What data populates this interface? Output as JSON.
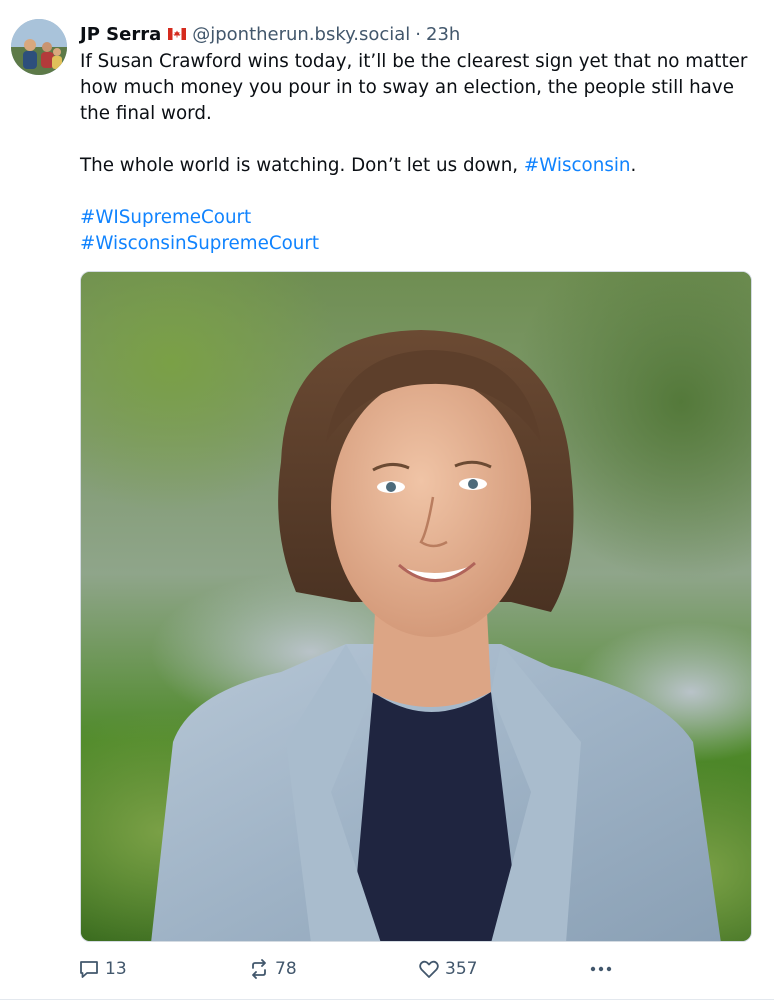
{
  "post": {
    "author": {
      "display_name": "JP Serra",
      "flag": "🇨🇦",
      "handle": "@jpontherun.bsky.social",
      "separator": "·",
      "time": "23h"
    },
    "text_para1": "If Susan Crawford wins today, it’ll be the clearest sign yet that no matter how much money you pour in to sway an election, the people still have the final word.",
    "text_para2_prefix": "The whole world is watching. Don’t let us down, ",
    "text_para2_tag": "#Wisconsin",
    "text_para2_suffix": ".",
    "hashtags": [
      "#WISupremeCourt",
      "#WisconsinSupremeCourt"
    ],
    "media": {
      "description": "Smiling woman with shoulder-length brown hair wearing a light blue herringbone blazer over a navy sweater, outdoors with blurred green trees behind"
    },
    "actions": {
      "reply_count": "13",
      "repost_count": "78",
      "like_count": "357"
    }
  },
  "colors": {
    "link": "#1083fe",
    "muted": "#42576c",
    "text": "#0b0f14"
  },
  "icons": {
    "reply": "speech-bubble-icon",
    "repost": "repost-arrows-icon",
    "like": "heart-icon",
    "more": "ellipsis-icon"
  }
}
